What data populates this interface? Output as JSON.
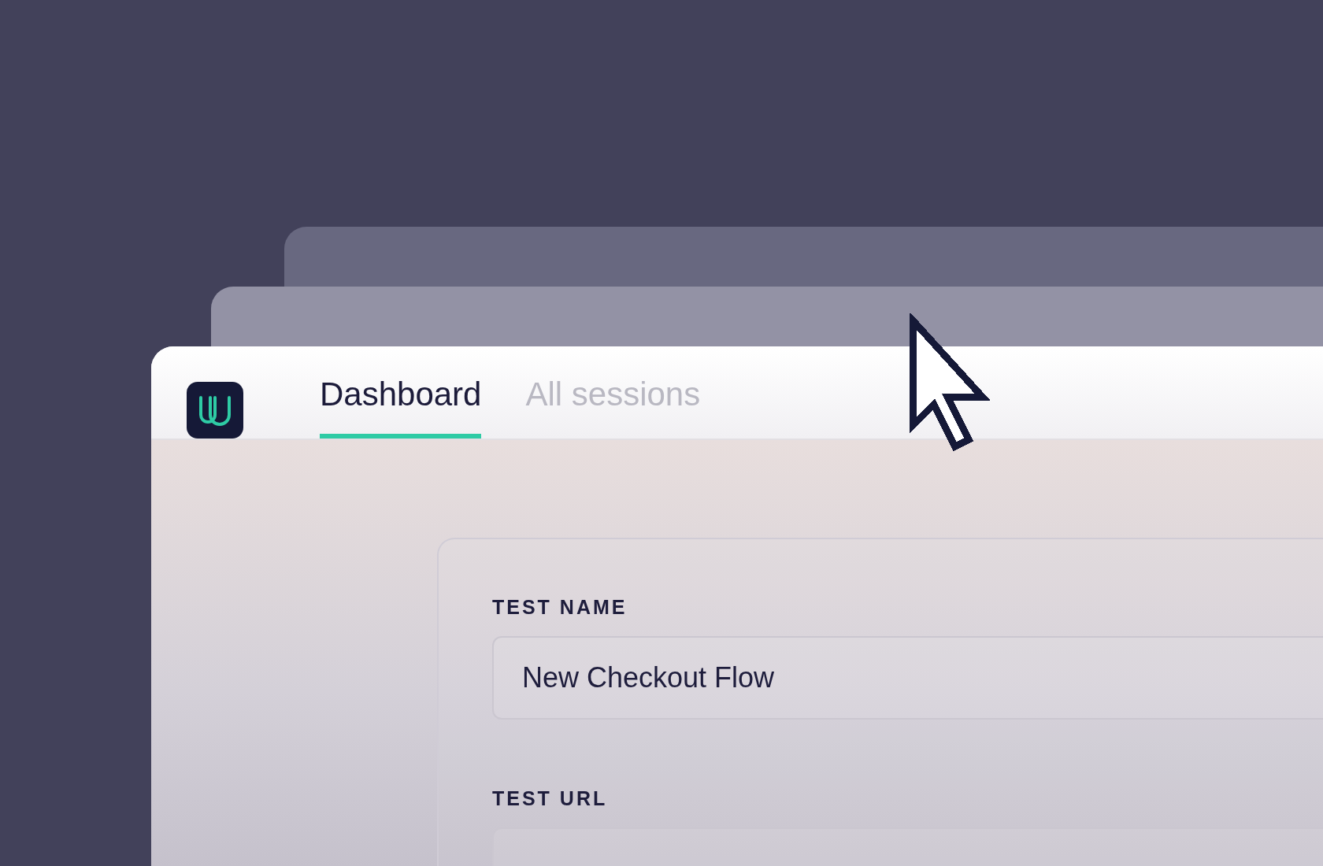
{
  "tabs": [
    {
      "label": "Dashboard",
      "selected": true
    },
    {
      "label": "All sessions",
      "selected": false
    }
  ],
  "form": {
    "fields": [
      {
        "label": "TEST NAME",
        "value": "New Checkout Flow"
      },
      {
        "label": "TEST URL"
      }
    ]
  }
}
